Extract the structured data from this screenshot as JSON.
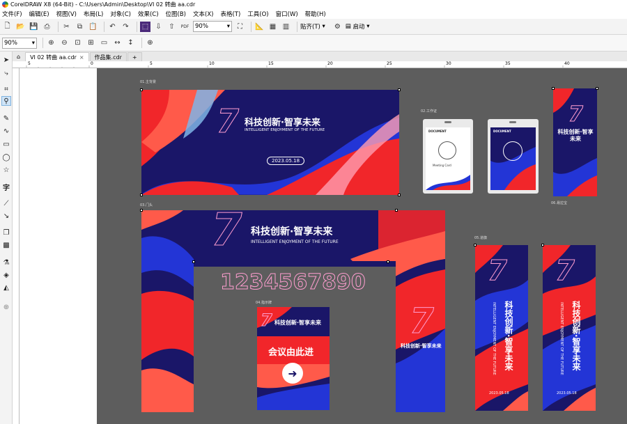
{
  "app": {
    "title": "CorelDRAW X8 (64-Bit) - C:\\Users\\Admin\\Desktop\\VI 02 转曲 aa.cdr"
  },
  "menu": [
    "文件(F)",
    "编辑(E)",
    "视图(V)",
    "布局(L)",
    "对象(C)",
    "效果(C)",
    "位图(B)",
    "文本(X)",
    "表格(T)",
    "工具(O)",
    "窗口(W)",
    "帮助(H)"
  ],
  "toolbar": {
    "zoom": "90%",
    "snap_label": "贴齐(T)",
    "launch_label": "启动",
    "pdf_label": "PDF"
  },
  "propbar": {
    "zoom": "90%"
  },
  "tabs": [
    {
      "label": "VI 02 转曲 aa.cdr"
    },
    {
      "label": "作品集.cdr"
    }
  ],
  "ruler_ticks": [
    "5",
    "0",
    "5",
    "10",
    "15",
    "20",
    "25",
    "30",
    "35",
    "40"
  ],
  "labels": {
    "bg": "01.主背景",
    "id": "02.工作证",
    "door": "03.门头",
    "sign": "04.指示牌",
    "flag": "05.道旗",
    "roll": "06.易拉宝"
  },
  "content": {
    "headline": "科技创新·智享未来",
    "subline": "INTELLIGENT ENJOYMENT OF THE FUTURE",
    "date": "2023.05.18",
    "numbers": "1234567890",
    "sign_text": "会议由此进",
    "seven": "7",
    "badge_text": "DOCUMENT",
    "badge_name": "Meeting Card"
  },
  "colors": {
    "navy": "#1a1668",
    "red": "#f1262a",
    "coral": "#ff5a4a",
    "blue": "#2335d6",
    "pink": "#ff9ed0",
    "desk": "#5d5d5d"
  }
}
